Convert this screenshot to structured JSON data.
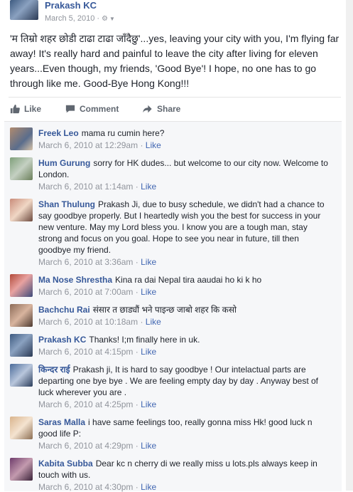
{
  "post": {
    "author": "Prakash KC",
    "date": "March 5, 2010",
    "separator": "·",
    "privacy_icon": "gear-icon",
    "text": "'म तिम्रो शहर छोडी टाढा टाढा जाँदैछु'...yes, leaving your city with you, I'm flying far away! It's really hard and painful to leave the city after living for eleven years...Even though, my friends, 'Good Bye'! I hope, no one has to go through like me. Good-Bye Hong Kong!!!"
  },
  "actions": {
    "like": "Like",
    "comment": "Comment",
    "share": "Share"
  },
  "colors": {
    "link": "#365899",
    "meta": "#90949c",
    "comment_bg": "#f6f7f9"
  },
  "comments": [
    {
      "name": "Freek Leo",
      "text": "mama ru cumin here?",
      "time": "March 6, 2010 at 12:29am",
      "like": "Like"
    },
    {
      "name": "Hum Gurung",
      "text": "sorry for HK dudes... but welcome to our city now. Welcome to London.",
      "time": "March 6, 2010 at 1:14am",
      "like": "Like"
    },
    {
      "name": "Shan Thulung",
      "text": "Prakash Ji, due to busy schedule, we didn't had a chance to say goodbye properly. But I heartedly wish you the best for success in your new venture. May my Lord bless you. I know you are a tough man, stay strong and focus on you goal. Hope to see you near in future, till then goodbye my friend.",
      "time": "March 6, 2010 at 3:36am",
      "like": "Like"
    },
    {
      "name": "Ma Nose Shrestha",
      "text": "Kina ra dai Nepal tira aaudai ho ki k ho",
      "time": "March 6, 2010 at 7:00am",
      "like": "Like"
    },
    {
      "name": "Bachchu Rai",
      "text": "संसार त छाड्यौं भने पाइन्छ जाबो शहर कि कसो",
      "time": "March 6, 2010 at 10:18am",
      "like": "Like"
    },
    {
      "name": "Prakash KC",
      "text": "Thanks! I;m finally here in uk.",
      "time": "March 6, 2010 at 4:15pm",
      "like": "Like"
    },
    {
      "name": "किन्दर राई",
      "text": "Prakash ji, It is hard to say goodbye ! Our intelactual parts are departing one bye bye . We are feeling empty day by day . Anyway best of luck wherever you are .",
      "time": "March 6, 2010 at 4:25pm",
      "like": "Like"
    },
    {
      "name": "Saras Malla",
      "text": "i have same feelings too, really gonna miss Hk! good luck n good life P:",
      "time": "March 6, 2010 at 4:29pm",
      "like": "Like"
    },
    {
      "name": "Kabita Subba",
      "text": "Dear kc n cherry di we really miss u lots.pls always keep in touch with us.",
      "time": "March 6, 2010 at 4:30pm",
      "like": "Like"
    }
  ],
  "meta_sep": "·"
}
